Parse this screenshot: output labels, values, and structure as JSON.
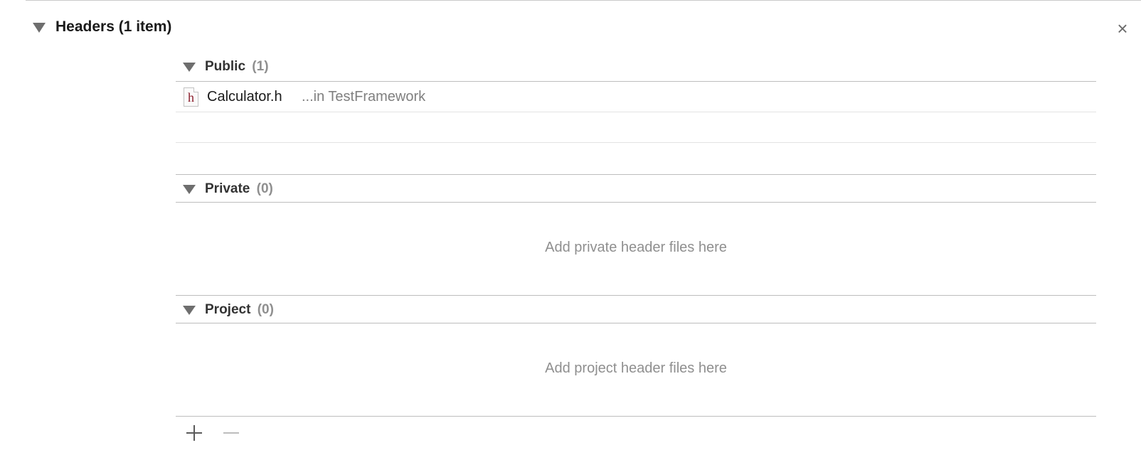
{
  "phase": {
    "title": "Headers (1 item)",
    "close_glyph": "×"
  },
  "sections": {
    "public": {
      "label": "Public",
      "count": "(1)",
      "files": [
        {
          "icon": "h",
          "name": "Calculator.h",
          "location": "...in TestFramework"
        }
      ]
    },
    "private": {
      "label": "Private",
      "count": "(0)",
      "placeholder": "Add private header files here"
    },
    "project": {
      "label": "Project",
      "count": "(0)",
      "placeholder": "Add project header files here"
    }
  },
  "toolbar": {
    "add_icon": "plus-icon",
    "remove_icon": "minus-icon"
  },
  "colors": {
    "header_icon_letter": "#8a1b2a",
    "muted_text": "#8f8f8f",
    "rule": "#bdbdbd"
  }
}
